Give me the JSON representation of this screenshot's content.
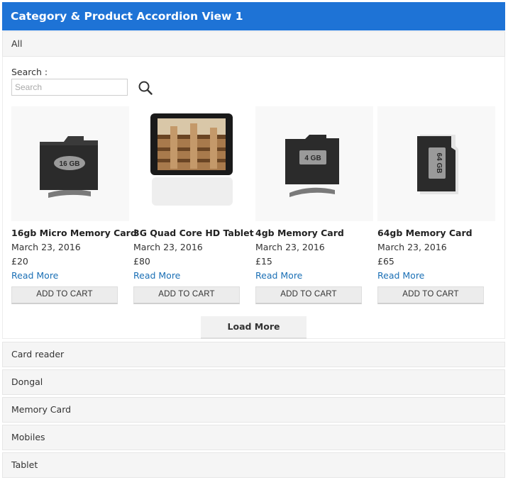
{
  "header": {
    "title": "Category & Product Accordion View 1"
  },
  "accordion": {
    "active": "All",
    "collapsed": [
      "Card reader",
      "Dongal",
      "Memory Card",
      "Mobiles",
      "Tablet"
    ]
  },
  "search": {
    "label": "Search :",
    "placeholder": "Search",
    "icon": "search-icon"
  },
  "products": [
    {
      "name": "16gb Micro Memory Card",
      "date": "March 23, 2016",
      "price": "£20",
      "read_more": "Read More",
      "cart": "ADD TO CART",
      "card_label": "16 GB"
    },
    {
      "name": "3G Quad Core HD Tablet",
      "date": "March 23, 2016",
      "price": "£80",
      "read_more": "Read More",
      "cart": "ADD TO CART"
    },
    {
      "name": "4gb Memory Card",
      "date": "March 23, 2016",
      "price": "£15",
      "read_more": "Read More",
      "cart": "ADD TO CART",
      "card_label": "4 GB"
    },
    {
      "name": "64gb Memory Card",
      "date": "March 23, 2016",
      "price": "£65",
      "read_more": "Read More",
      "cart": "ADD TO CART",
      "card_label": "64 GB"
    }
  ],
  "load_more": "Load More",
  "colors": {
    "header": "#1e73d6",
    "link": "#1a6fb5"
  }
}
